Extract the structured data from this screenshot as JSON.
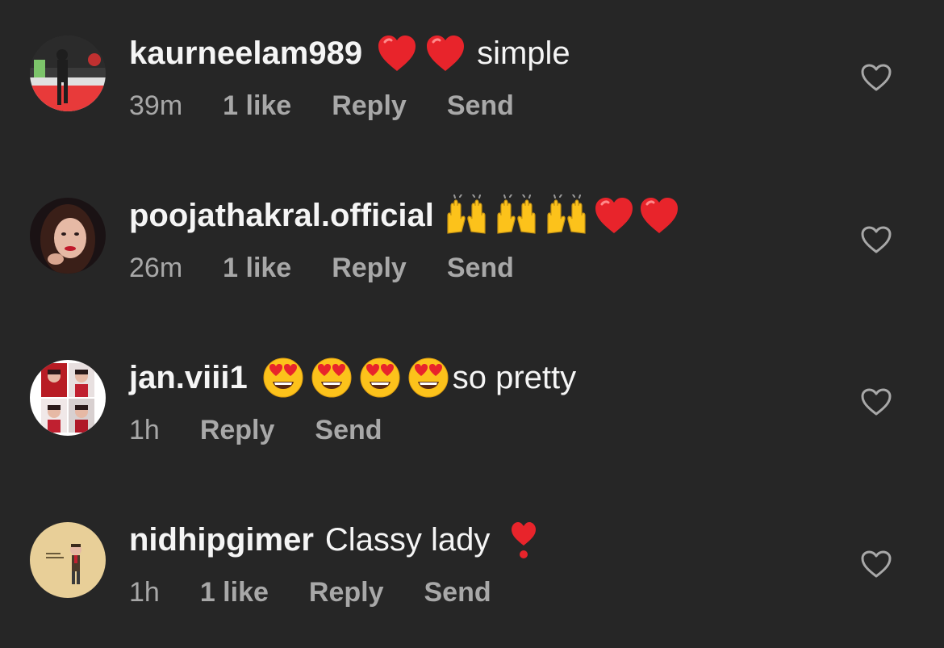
{
  "colors": {
    "background": "#262626",
    "primary_text": "#f5f5f5",
    "secondary_text": "#a8a8a8"
  },
  "comments": [
    {
      "username": "kaurneelam989",
      "emojis": [
        "red-heart",
        "red-heart"
      ],
      "text": "simple",
      "time": "39m",
      "likes": "1 like",
      "reply": "Reply",
      "send": "Send"
    },
    {
      "username": "poojathakral.official",
      "emojis": [
        "raising-hands",
        "raising-hands",
        "raising-hands",
        "red-heart",
        "red-heart"
      ],
      "text": "",
      "time": "26m",
      "likes": "1 like",
      "reply": "Reply",
      "send": "Send"
    },
    {
      "username": "jan.viii1",
      "emojis": [
        "heart-eyes",
        "heart-eyes",
        "heart-eyes",
        "heart-eyes"
      ],
      "text": "so pretty",
      "time": "1h",
      "likes": "",
      "reply": "Reply",
      "send": "Send"
    },
    {
      "username": "nidhipgimer",
      "emojis": [],
      "text": "Classy lady",
      "trailing_emoji": "heart-exclamation",
      "time": "1h",
      "likes": "1 like",
      "reply": "Reply",
      "send": "Send"
    }
  ]
}
